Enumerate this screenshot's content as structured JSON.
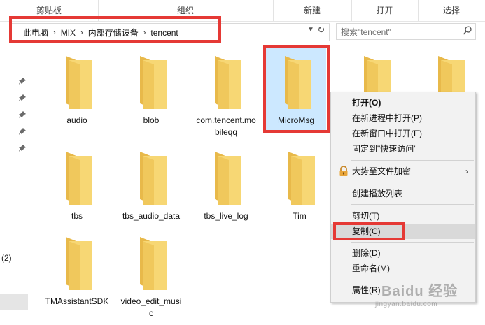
{
  "ribbon": {
    "groups": [
      "剪贴板",
      "组织",
      "新建",
      "打开",
      "选择"
    ]
  },
  "address": {
    "crumbs": [
      "此电脑",
      "MIX",
      "内部存储设备",
      "tencent"
    ]
  },
  "search": {
    "placeholder": "搜索\"tencent\""
  },
  "nav": {
    "count_label": "(2)"
  },
  "folders": [
    {
      "name": "audio"
    },
    {
      "name": "blob"
    },
    {
      "name": "com.tencent.mobileqq"
    },
    {
      "name": "MicroMsg"
    },
    {
      "name": "tbs"
    },
    {
      "name": "tbs_audio_data"
    },
    {
      "name": "tbs_live_log"
    },
    {
      "name": "Tim"
    },
    {
      "name": "TMAssistantSDK"
    },
    {
      "name": "video_edit_music"
    }
  ],
  "context_menu": {
    "items": [
      {
        "label": "打开(O)"
      },
      {
        "label": "在新进程中打开(P)"
      },
      {
        "label": "在新窗口中打开(E)"
      },
      {
        "label": "固定到\"快速访问\""
      },
      {
        "label": "大势至文件加密"
      },
      {
        "label": "创建播放列表"
      },
      {
        "label": "剪切(T)"
      },
      {
        "label": "复制(C)"
      },
      {
        "label": "删除(D)"
      },
      {
        "label": "重命名(M)"
      },
      {
        "label": "属性(R)"
      }
    ]
  },
  "watermark": {
    "text": "Baidu 经验",
    "sub": "jingyan.baidu.com"
  },
  "colors": {
    "highlight": "#e53935",
    "selection": "#cce8ff",
    "folder": "#f7d774"
  }
}
